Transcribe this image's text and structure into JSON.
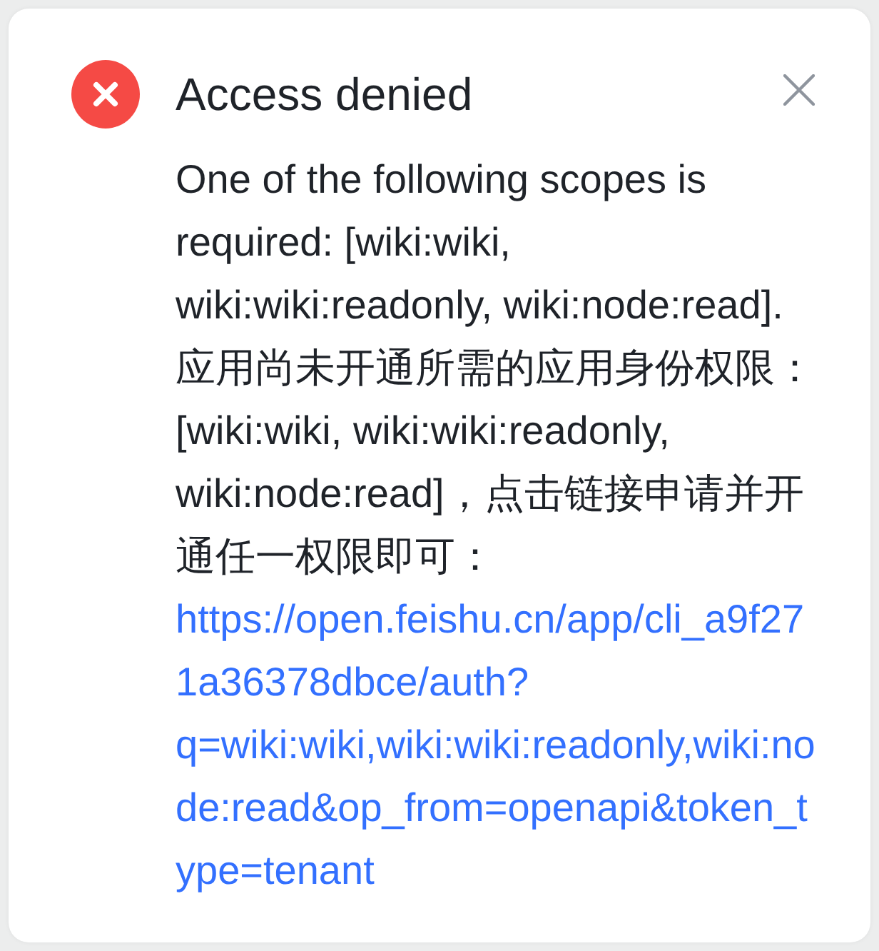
{
  "dialog": {
    "kind": "error",
    "title": "Access denied",
    "message": "One of the following scopes is required: [wiki:wiki, wiki:wiki:readonly, wiki:node:read]. 应用尚未开通所需的应用身份权限：[wiki:wiki, wiki:wiki:readonly, wiki:node:read]，点击链接申请并开通任一权限即可：",
    "link": "https://open.feishu.cn/app/cli_a9f271a36378dbce/auth?q=wiki:wiki,wiki:wiki:readonly,wiki:node:read&op_from=openapi&token_type=tenant"
  }
}
